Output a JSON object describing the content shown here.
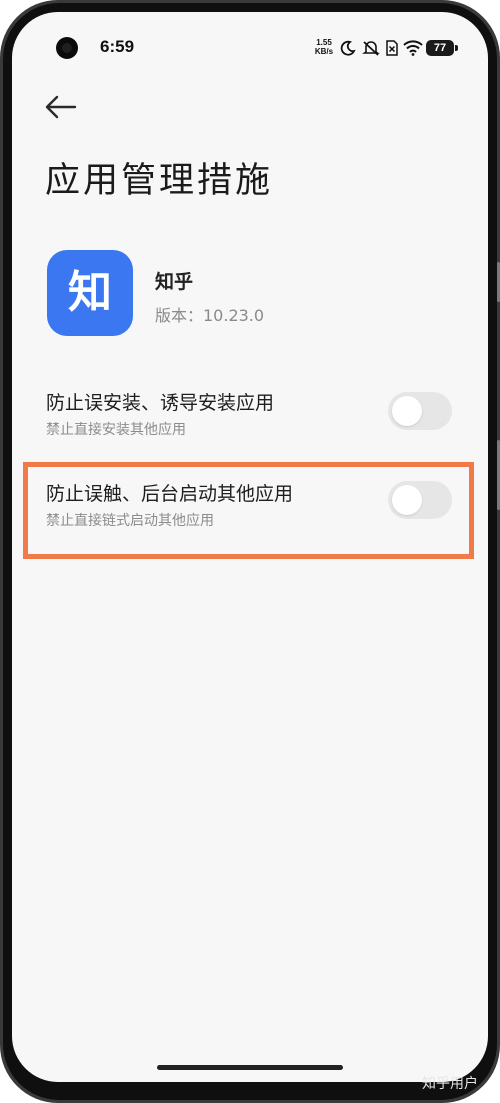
{
  "status_bar": {
    "time": "6:59",
    "net_speed_value": "1.55",
    "net_speed_unit": "KB/s",
    "battery": "77",
    "icons": [
      "moon-icon",
      "mute-icon",
      "sim-off-icon",
      "wifi-icon",
      "battery-icon"
    ]
  },
  "header": {
    "back_icon": "arrow-left-icon",
    "title": "应用管理措施"
  },
  "app": {
    "icon_glyph": "知",
    "name": "知乎",
    "version": "版本：10.23.0",
    "icon_color": "#3a77f0"
  },
  "settings": [
    {
      "title": "防止误安装、诱导安装应用",
      "subtitle": "禁止直接安装其他应用",
      "enabled": false
    },
    {
      "title": "防止误触、后台启动其他应用",
      "subtitle": "禁止直接链式启动其他应用",
      "enabled": false,
      "highlighted": true
    }
  ],
  "colors": {
    "highlight": "#f07a48",
    "toggle_off": "#e6e6e6"
  },
  "watermark": "知乎用户"
}
